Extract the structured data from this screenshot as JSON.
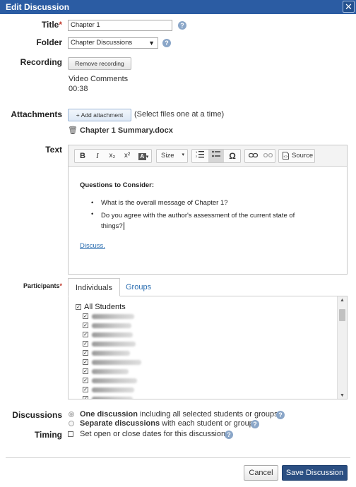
{
  "window": {
    "title": "Edit Discussion",
    "close": "✕"
  },
  "title_field": {
    "label": "Title",
    "required": "*",
    "value": "Chapter 1"
  },
  "folder": {
    "label": "Folder",
    "value": "Chapter Discussions"
  },
  "recording": {
    "label": "Recording",
    "remove_button": "Remove recording",
    "name": "Video Comments",
    "duration": "00:38"
  },
  "attachments": {
    "label": "Attachments",
    "add_button": "+ Add attachment",
    "hint": "(Select files one at a time)",
    "file": "Chapter 1 Summary.docx"
  },
  "text": {
    "label": "Text",
    "toolbar": {
      "bold": "B",
      "italic": "I",
      "subscript": "x₂",
      "superscript": "x²",
      "size": "Size",
      "special_char": "Ω",
      "source": "Source"
    },
    "content": {
      "heading": "Questions to Consider:",
      "bullets": [
        "What is the overall message of Chapter 1?",
        "Do you agree with the author's assessment of the current state of things?"
      ],
      "link": "Discuss."
    }
  },
  "participants": {
    "label": "Participants",
    "required": "*",
    "tabs": [
      "Individuals",
      "Groups"
    ],
    "all_label": "All Students"
  },
  "discussions": {
    "label": "Discussions",
    "option1_bold": "One discussion",
    "option1_rest": " including all selected students or groups",
    "option2_bold": "Separate discussions",
    "option2_rest": " with each student or group"
  },
  "timing": {
    "label": "Timing",
    "checkbox_label": "Set open or close dates for this discussion"
  },
  "footer": {
    "cancel": "Cancel",
    "save": "Save Discussion"
  },
  "colors": {
    "titlebar": "#2b5ca3",
    "save_button": "#2b4f82",
    "link": "#2a6db0",
    "required": "#c0392b"
  }
}
